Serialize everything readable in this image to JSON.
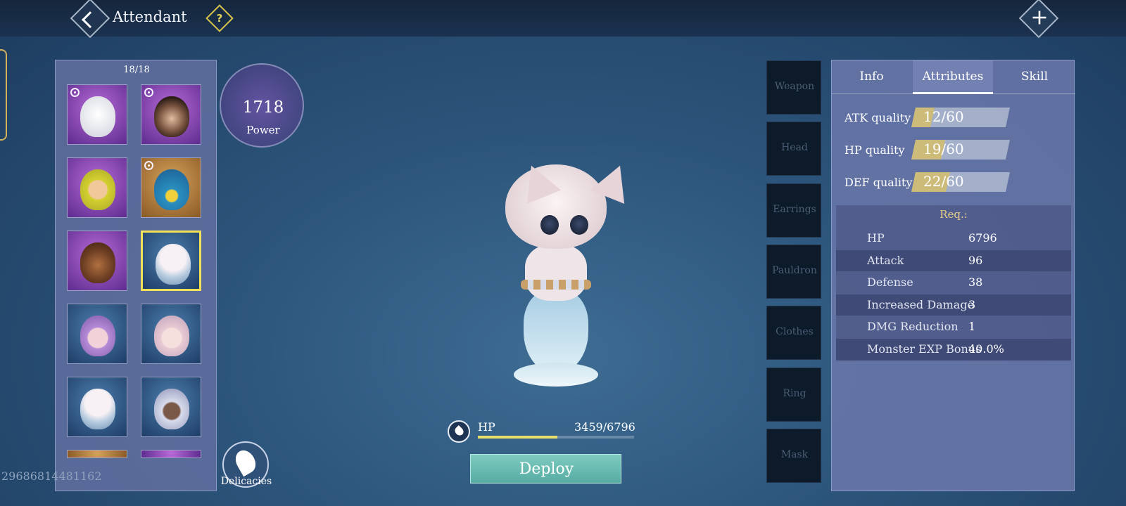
{
  "header": {
    "title": "Attendant",
    "help_icon": "question-mark-icon",
    "close_icon": "crossed-swords-close-icon"
  },
  "list": {
    "count": "18/18",
    "cards": [
      {
        "portrait": "white-fox",
        "locked": true,
        "frame": "purple",
        "selected": false
      },
      {
        "portrait": "chimpanzee",
        "locked": true,
        "frame": "purple",
        "selected": false
      },
      {
        "portrait": "yellow-haired-girl",
        "locked": false,
        "frame": "purple",
        "selected": false
      },
      {
        "portrait": "blue-parrot",
        "locked": true,
        "frame": "orange",
        "selected": false
      },
      {
        "portrait": "brown-bear",
        "locked": false,
        "frame": "purple",
        "selected": false
      },
      {
        "portrait": "mermaid-kitten",
        "locked": false,
        "frame": "blue",
        "selected": true
      },
      {
        "portrait": "purple-haired-girl",
        "locked": false,
        "frame": "blue",
        "selected": false
      },
      {
        "portrait": "pink-haired-girl",
        "locked": false,
        "frame": "blue",
        "selected": false
      },
      {
        "portrait": "mermaid-kitten",
        "locked": false,
        "frame": "blue",
        "selected": false
      },
      {
        "portrait": "elder-king",
        "locked": false,
        "frame": "blue",
        "selected": false
      }
    ]
  },
  "power": {
    "value": "1718",
    "label": "Power"
  },
  "delicacies": {
    "label": "Delicacies"
  },
  "player_id": "29686814481162",
  "hp": {
    "label": "HP",
    "value": "3459/6796",
    "fraction": 0.509
  },
  "deploy": {
    "label": "Deploy"
  },
  "slots": [
    "Weapon",
    "Head",
    "Earrings",
    "Pauldron",
    "Clothes",
    "Ring",
    "Mask"
  ],
  "tabs": {
    "info": "Info",
    "attributes": "Attributes",
    "skill": "Skill",
    "active": "attributes"
  },
  "qualities": [
    {
      "label": "ATK quality",
      "current": 12,
      "max": 60,
      "text": "12/60"
    },
    {
      "label": "HP quality",
      "current": 19,
      "max": 60,
      "text": "19/60"
    },
    {
      "label": "DEF quality",
      "current": 22,
      "max": 60,
      "text": "22/60"
    }
  ],
  "requirements": {
    "title": "Req.:",
    "rows": [
      {
        "name": "HP",
        "value": "6796"
      },
      {
        "name": "Attack",
        "value": "96"
      },
      {
        "name": "Defense",
        "value": "38"
      },
      {
        "name": "Increased Damage",
        "value": "3"
      },
      {
        "name": "DMG Reduction",
        "value": "1"
      },
      {
        "name": "Monster EXP Bonus",
        "value": "40.0%"
      }
    ]
  },
  "colors": {
    "accent_gold": "#f1e05a",
    "deploy_teal": "#6cbbb1",
    "hp_bar": "#e8df6a"
  }
}
